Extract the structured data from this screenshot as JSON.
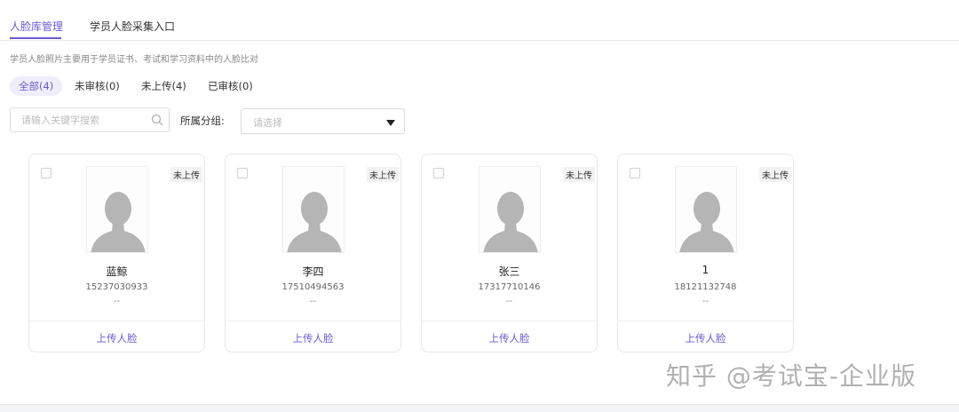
{
  "tabs": [
    {
      "label": "人脸库管理",
      "active": true
    },
    {
      "label": "学员人脸采集入口",
      "active": false
    }
  ],
  "description": "学员人脸照片主要用于学员证书、考试和学习资料中的人脸比对",
  "filters": [
    {
      "label": "全部(4)",
      "active": true
    },
    {
      "label": "未审核(0)",
      "active": false
    },
    {
      "label": "未上传(4)",
      "active": false
    },
    {
      "label": "已审核(0)",
      "active": false
    }
  ],
  "search": {
    "placeholder": "请输入关键字搜索",
    "value": "",
    "icon": "search-icon"
  },
  "group_filter": {
    "label": "所属分组:",
    "placeholder": "请选择",
    "icon": "caret-down-icon"
  },
  "cards": [
    {
      "name": "蓝鲸",
      "phone": "15237030933",
      "extra": "--",
      "status": "未上传",
      "action": "上传人脸"
    },
    {
      "name": "李四",
      "phone": "17510494563",
      "extra": "--",
      "status": "未上传",
      "action": "上传人脸"
    },
    {
      "name": "张三",
      "phone": "17317710146",
      "extra": "--",
      "status": "未上传",
      "action": "上传人脸"
    },
    {
      "name": "1",
      "phone": "18121132748",
      "extra": "--",
      "status": "未上传",
      "action": "上传人脸"
    }
  ],
  "watermark": "知乎 @考试宝-企业版",
  "colors": {
    "accent": "#6b5bd6",
    "border": "#e8e8e8",
    "placeholder": "#bbbbbb",
    "avatar": "#b5b5b5"
  }
}
